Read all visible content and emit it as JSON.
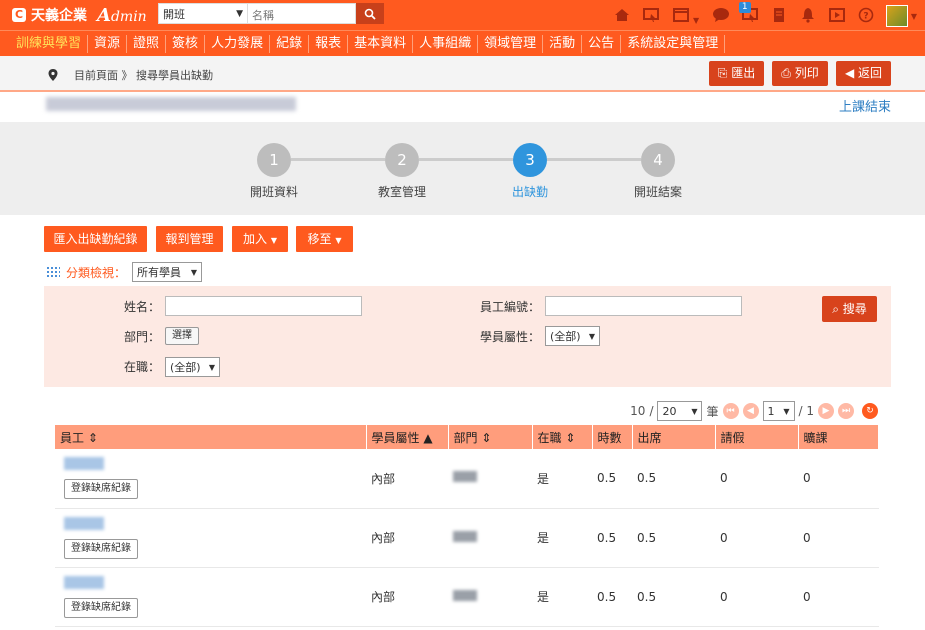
{
  "brand": {
    "company": "天義企業",
    "admin_prefix": "A",
    "admin_suffix": "dmin"
  },
  "search": {
    "module_value": "開班",
    "placeholder": "名稱"
  },
  "top_icons": {
    "badge_count": "1"
  },
  "nav": [
    {
      "label": "訓練與學習",
      "active": true
    },
    {
      "label": "資源"
    },
    {
      "label": "證照"
    },
    {
      "label": "簽核"
    },
    {
      "label": "人力發展"
    },
    {
      "label": "紀錄"
    },
    {
      "label": "報表"
    },
    {
      "label": "基本資料"
    },
    {
      "label": "人事組織"
    },
    {
      "label": "領域管理"
    },
    {
      "label": "活動"
    },
    {
      "label": "公告"
    },
    {
      "label": "系統設定與管理"
    }
  ],
  "breadcrumb": {
    "text": "目前頁面 》 搜尋學員出缺勤"
  },
  "actions": {
    "export": "匯出",
    "print": "列印",
    "back": "返回"
  },
  "end_class_link": "上課結束",
  "steps": [
    {
      "num": "1",
      "label": "開班資料"
    },
    {
      "num": "2",
      "label": "教室管理"
    },
    {
      "num": "3",
      "label": "出缺勤",
      "active": true
    },
    {
      "num": "4",
      "label": "開班結案"
    }
  ],
  "toolbar": {
    "import": "匯入出缺勤紀錄",
    "report": "報到管理",
    "add": "加入",
    "move": "移至"
  },
  "filter": {
    "label": "分類檢視：",
    "value": "所有學員"
  },
  "form": {
    "name_label": "姓名：",
    "emp_no_label": "員工編號：",
    "dept_label": "部門：",
    "dept_button": "選擇",
    "student_type_label": "學員屬性：",
    "student_type_value": "(全部)",
    "employed_label": "在職：",
    "employed_value": "(全部)",
    "search_button": "搜尋"
  },
  "pager": {
    "total": "10",
    "slash": "/",
    "page_size": "20",
    "unit": "筆",
    "page": "1",
    "pages": "/ 1"
  },
  "table": {
    "headers": {
      "employee": "員工 ⇕",
      "type": "學員屬性 ▲",
      "dept": "部門 ⇕",
      "employed": "在職 ⇕",
      "hours": "時數",
      "attend": "出席",
      "leave": "請假",
      "absent": "曠課"
    },
    "record_button": "登錄缺席紀錄",
    "rows": [
      {
        "type": "內部",
        "employed": "是",
        "hours": "0.5",
        "attend": "0.5",
        "leave": "0",
        "absent": "0"
      },
      {
        "type": "內部",
        "employed": "是",
        "hours": "0.5",
        "attend": "0.5",
        "leave": "0",
        "absent": "0"
      },
      {
        "type": "內部",
        "employed": "是",
        "hours": "0.5",
        "attend": "0.5",
        "leave": "0",
        "absent": "0"
      }
    ]
  },
  "colors": {
    "brand_orange": "#ff5a1f",
    "active_step": "#2f95dd",
    "panel_bg": "#fde9e3"
  }
}
